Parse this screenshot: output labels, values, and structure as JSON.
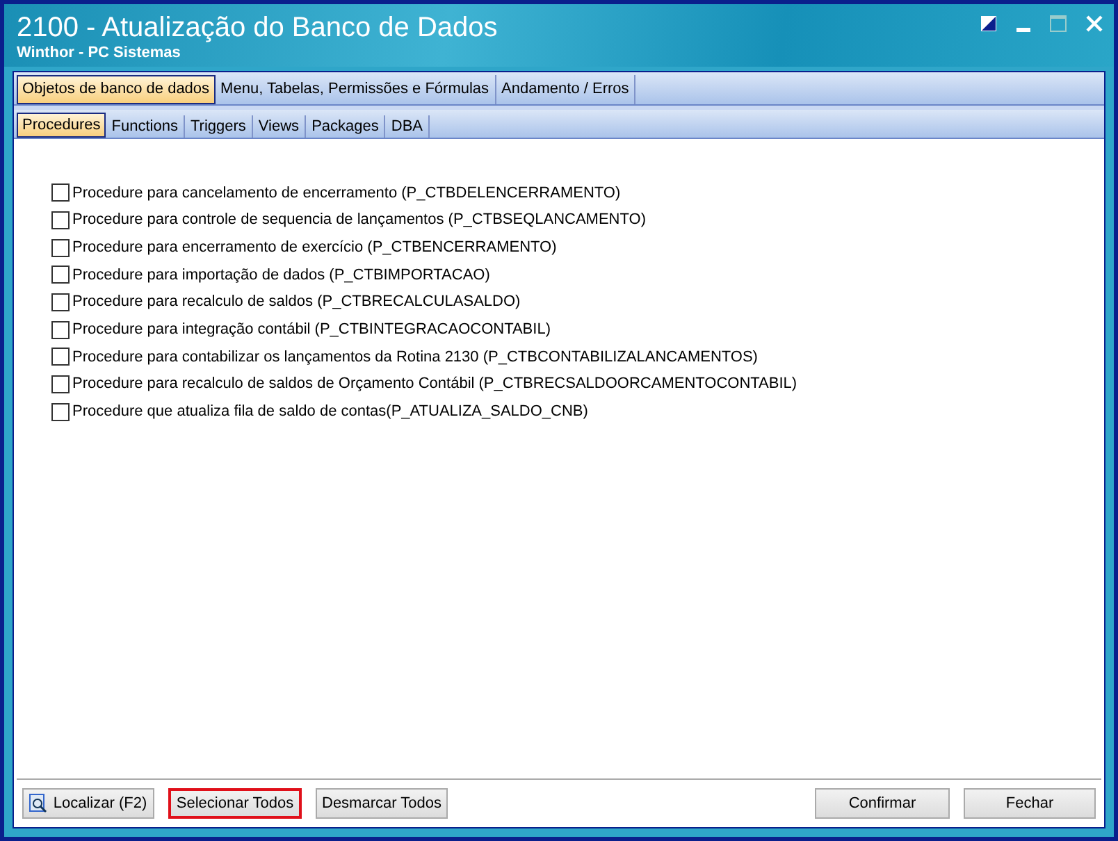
{
  "window": {
    "title": "2100 - Atualização do Banco de Dados",
    "subtitle": "Winthor - PC Sistemas"
  },
  "tabs": [
    {
      "label": "Objetos de banco de dados",
      "selected": true
    },
    {
      "label": "Menu, Tabelas, Permissões e Fórmulas",
      "selected": false
    },
    {
      "label": "Andamento / Erros",
      "selected": false
    }
  ],
  "subtabs": [
    {
      "label": "Procedures",
      "selected": true
    },
    {
      "label": "Functions",
      "selected": false
    },
    {
      "label": "Triggers",
      "selected": false
    },
    {
      "label": "Views",
      "selected": false
    },
    {
      "label": "Packages",
      "selected": false
    },
    {
      "label": "DBA",
      "selected": false
    }
  ],
  "procedures": [
    {
      "label": "Procedure para cancelamento de encerramento (P_CTBDELENCERRAMENTO)",
      "checked": false
    },
    {
      "label": "Procedure para controle de sequencia de lançamentos (P_CTBSEQLANCAMENTO)",
      "checked": false
    },
    {
      "label": "Procedure para encerramento de exercício (P_CTBENCERRAMENTO)",
      "checked": false
    },
    {
      "label": "Procedure para importação de dados (P_CTBIMPORTACAO)",
      "checked": false
    },
    {
      "label": "Procedure para recalculo de saldos (P_CTBRECALCULASALDO)",
      "checked": false
    },
    {
      "label": "Procedure para integração contábil (P_CTBINTEGRACAOCONTABIL)",
      "checked": false
    },
    {
      "label": "Procedure para contabilizar os lançamentos da Rotina 2130 (P_CTBCONTABILIZALANCAMENTOS)",
      "checked": false
    },
    {
      "label": "Procedure para recalculo de saldos de Orçamento Contábil (P_CTBRECSALDOORCAMENTOCONTABIL)",
      "checked": false
    },
    {
      "label": "Procedure que atualiza fila de saldo de contas(P_ATUALIZA_SALDO_CNB)",
      "checked": false
    }
  ],
  "buttons_left": [
    {
      "label": "Localizar (F2)",
      "kind": "search",
      "highlighted": false
    },
    {
      "label": "Selecionar Todos",
      "kind": "plain",
      "highlighted": true
    },
    {
      "label": "Desmarcar Todos",
      "kind": "plain",
      "highlighted": false
    }
  ],
  "buttons_right": [
    {
      "label": "Confirmar",
      "highlighted": false
    },
    {
      "label": "Fechar",
      "highlighted": false
    }
  ]
}
